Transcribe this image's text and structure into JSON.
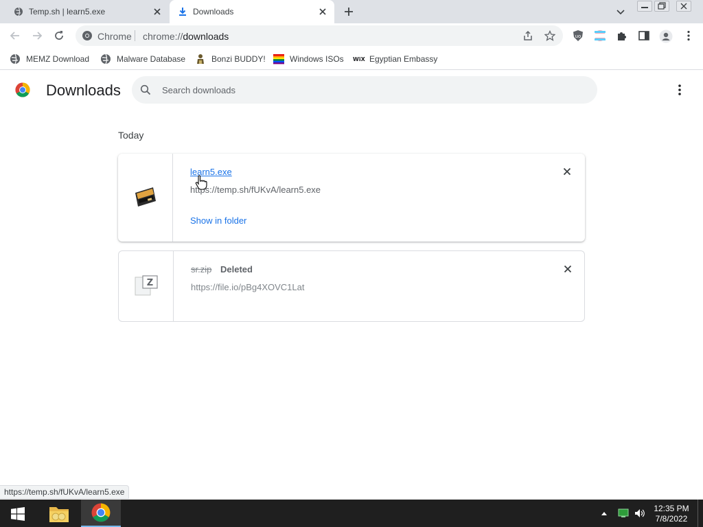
{
  "tabs": [
    {
      "title": "Temp.sh | learn5.exe",
      "active": false
    },
    {
      "title": "Downloads",
      "active": true
    }
  ],
  "toolbar": {
    "site_label": "Chrome",
    "url_prefix": "chrome://",
    "url_host": "downloads"
  },
  "bookmarks": [
    {
      "label": "MEMZ Download",
      "icon": "globe-icon"
    },
    {
      "label": "Malware Database",
      "icon": "globe-icon"
    },
    {
      "label": "Bonzi BUDDY!",
      "icon": "bonzi-icon"
    },
    {
      "label": "Windows ISOs",
      "icon": "rainbow-flag-icon"
    },
    {
      "label": "Egyptian Embassy",
      "icon": "wix-icon"
    }
  ],
  "downloads_page": {
    "title": "Downloads",
    "search_placeholder": "Search downloads",
    "section_label": "Today",
    "items": [
      {
        "filename": "learn5.exe",
        "url": "https://temp.sh/fUKvA/learn5.exe",
        "action": "Show in folder",
        "status": ""
      },
      {
        "filename": "sr.zip",
        "url": "https://file.io/pBg4XOVC1Lat",
        "action": "",
        "status": "Deleted"
      }
    ]
  },
  "status_bar": "https://temp.sh/fUKvA/learn5.exe",
  "taskbar": {
    "time": "12:35 PM",
    "date": "7/8/2022"
  },
  "colors": {
    "link_blue": "#1a73e8",
    "tab_strip": "#dee1e6",
    "taskbar": "#1f1f1f"
  }
}
